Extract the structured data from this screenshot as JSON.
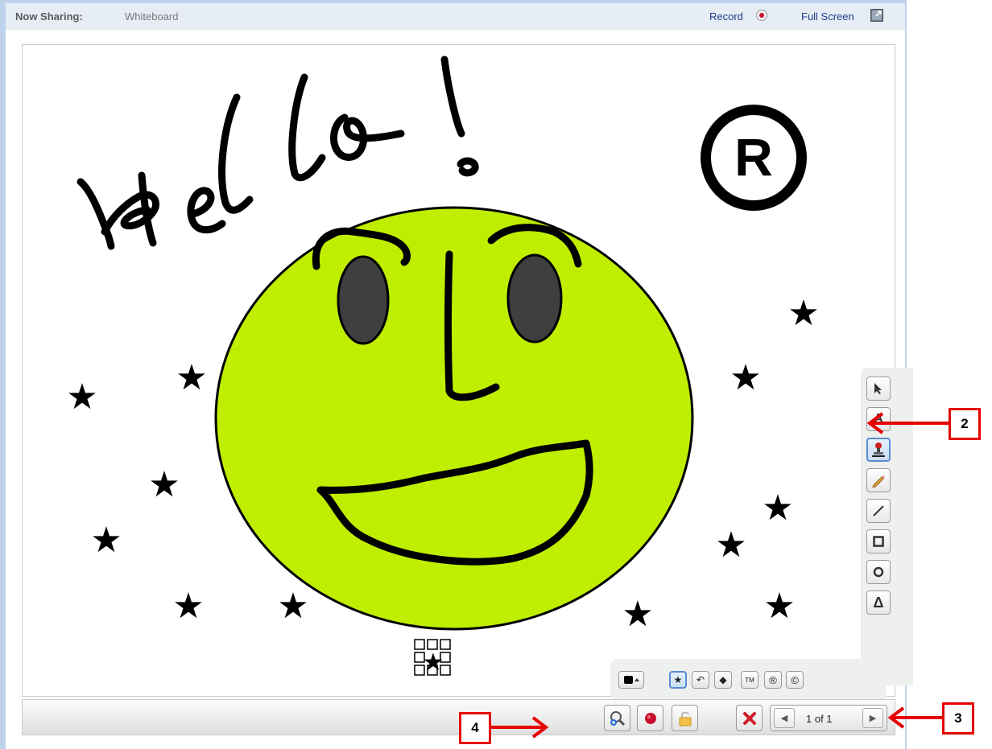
{
  "header": {
    "share_label": "Now Sharing:",
    "share_value": "Whiteboard",
    "record_label": "Record",
    "fullscreen_label": "Full Screen"
  },
  "canvas": {
    "greeting": "Hello!",
    "face_color": "#bfee00",
    "stamp_symbol": "®"
  },
  "tools": [
    {
      "name": "select-tool",
      "icon": "cursor-icon"
    },
    {
      "name": "text-tool",
      "icon": "text-icon",
      "glyph": "A"
    },
    {
      "name": "stamp-tool",
      "icon": "stamp-icon",
      "active": true
    },
    {
      "name": "pencil-tool",
      "icon": "pencil-icon"
    },
    {
      "name": "line-tool",
      "icon": "line-icon"
    },
    {
      "name": "rectangle-tool",
      "icon": "rectangle-icon"
    },
    {
      "name": "ellipse-tool",
      "icon": "ellipse-icon"
    },
    {
      "name": "triangle-tool",
      "icon": "triangle-icon",
      "glyph": "Δ"
    }
  ],
  "stamps": [
    {
      "name": "stamp-color-picker",
      "icon": "color-picker-icon"
    },
    {
      "name": "star-stamp",
      "icon": "star-icon",
      "glyph": "★",
      "active": true
    },
    {
      "name": "arrow-stamp",
      "icon": "curved-arrow-icon",
      "glyph": "↶"
    },
    {
      "name": "diamond-stamp",
      "icon": "diamond-icon",
      "glyph": "◆"
    },
    {
      "name": "trademark-stamp",
      "icon": "trademark-icon",
      "glyph": "TM"
    },
    {
      "name": "registered-stamp",
      "icon": "registered-icon",
      "glyph": "®"
    },
    {
      "name": "copyright-stamp",
      "icon": "copyright-icon",
      "glyph": "©"
    }
  ],
  "bottombar": {
    "page_indicator": "1 of 1"
  },
  "callouts": {
    "two": "2",
    "three": "3",
    "four": "4"
  },
  "colors": {
    "accent": "#5a8ad1",
    "callout_red": "#e60000"
  }
}
